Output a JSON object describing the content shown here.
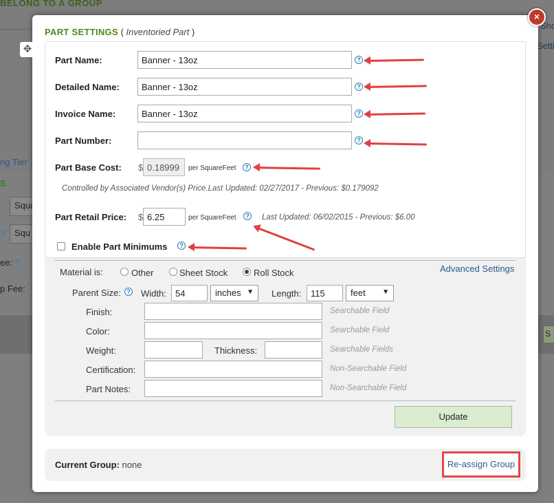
{
  "background": {
    "page_title": "BELONG TO A GROUP",
    "right_text_1": "Sho",
    "right_text_2": "Setti",
    "left_text_1": "ng Tier",
    "left_text_2": "S",
    "select_1": "Squa",
    "select_2": "Squ",
    "label_1": "ee:",
    "label_2": "p Fee:",
    "right_button": "S"
  },
  "modal": {
    "title": "PART SETTINGS",
    "subtitle": "Inventoried Part",
    "fields": {
      "part_name": {
        "label": "Part Name:",
        "value": "Banner - 13oz"
      },
      "detailed_name": {
        "label": "Detailed Name:",
        "value": "Banner - 13oz"
      },
      "invoice_name": {
        "label": "Invoice Name:",
        "value": "Banner - 13oz"
      },
      "part_number": {
        "label": "Part Number:",
        "value": ""
      },
      "base_cost": {
        "label": "Part Base Cost:",
        "value": "0.18999",
        "currency": "$",
        "unit": "per SquareFeet"
      },
      "base_cost_note": "Controlled by Associated Vendor(s) Price.Last Updated: 02/27/2017 - Previous: $0.179092",
      "retail_price": {
        "label": "Part Retail Price:",
        "value": "6.25",
        "currency": "$",
        "unit": "per SquareFeet",
        "note": "Last Updated: 06/02/2015 - Previous: $6.00"
      },
      "enable_minimums": {
        "label": "Enable Part Minimums",
        "checked": false
      }
    },
    "material": {
      "label": "Material is:",
      "options": [
        "Other",
        "Sheet Stock",
        "Roll Stock"
      ],
      "selected": "Roll Stock",
      "advanced_link": "Advanced Settings",
      "parent_size_label": "Parent Size:",
      "width_label": "Width:",
      "width_value": "54",
      "width_unit": "inches",
      "length_label": "Length:",
      "length_value": "115",
      "length_unit": "feet",
      "finish": {
        "label": "Finish:",
        "hint": "Searchable Field"
      },
      "color": {
        "label": "Color:",
        "hint": "Searchable Field"
      },
      "weight": {
        "label": "Weight:"
      },
      "thickness": {
        "label": "Thickness:",
        "hint": "Searchable Fields"
      },
      "certification": {
        "label": "Certification:",
        "hint": "Non-Searchable Field"
      },
      "part_notes": {
        "label": "Part Notes:",
        "hint": "Non-Searchable Field"
      }
    },
    "update_label": "Update",
    "group": {
      "label": "Current Group:",
      "value": "none",
      "reassign_label": "Re-assign Group"
    },
    "help_glyph": "?",
    "close_glyph": "×",
    "move_glyph": "✥",
    "caret_glyph": "▼"
  },
  "colors": {
    "title_green": "#4a8a1a",
    "annotation_red": "#e04040",
    "link_blue": "#2c5a8a",
    "close_red": "#c0392b",
    "update_bg": "#dbecd0"
  }
}
